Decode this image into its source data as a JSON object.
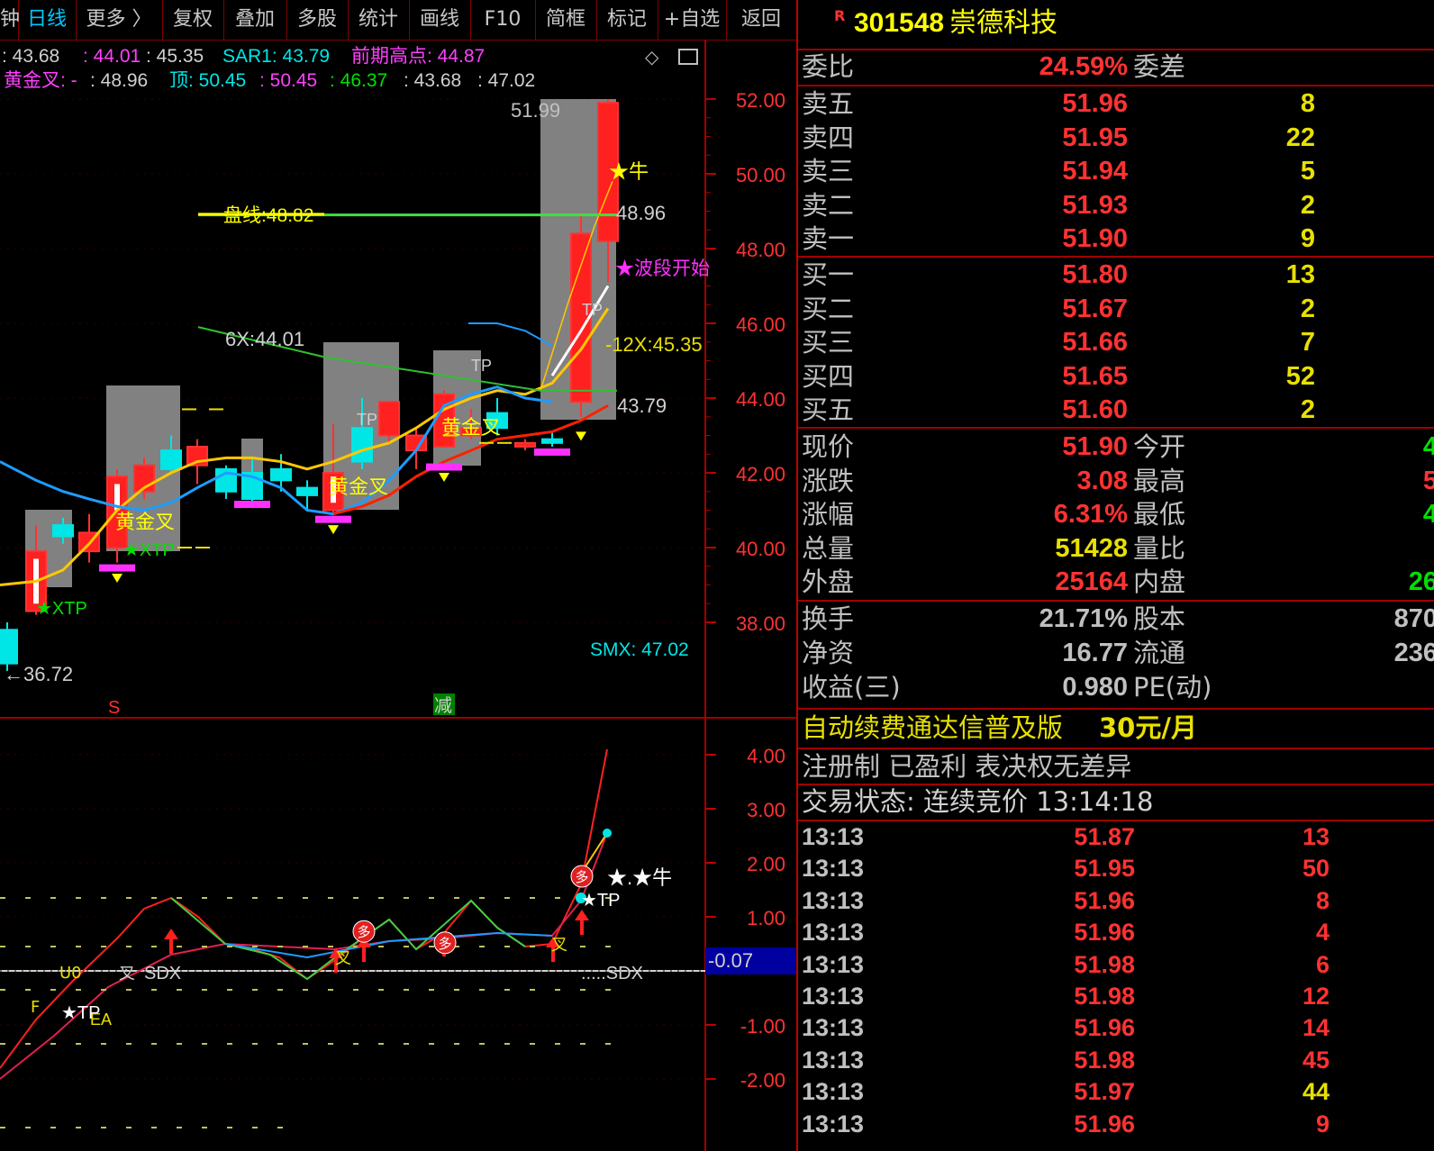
{
  "toolbar": {
    "items": [
      "钟",
      "日线",
      "更多 〉",
      "复权",
      "叠加",
      "多股",
      "统计",
      "画线",
      "F10",
      "简框",
      "标记",
      "+自选",
      "返回"
    ]
  },
  "indicator_line1": {
    "a": ": 43.68",
    "b": ": 44.01",
    "c": ": 45.35",
    "sar": "SAR1: 43.79",
    "prev_high": "前期高点: 44.87"
  },
  "indicator_line2": {
    "gold": "黄金叉: -",
    "v1": ": 48.96",
    "top": "顶: 50.45",
    "v2": ": 50.45",
    "v3": ": 46.37",
    "v4": ": 43.68",
    "v5": ": 47.02"
  },
  "price_axis": [
    "52.00",
    "50.00",
    "48.00",
    "46.00",
    "44.00",
    "42.00",
    "40.00",
    "38.00"
  ],
  "osc_axis": [
    "4.00",
    "3.00",
    "2.00",
    "1.00",
    "0.00",
    "-1.00",
    "-2.00"
  ],
  "osc_value": "-0.07",
  "chart_labels": {
    "high": "51.99",
    "low": "←36.72",
    "pan": "盘线:48.82",
    "line_4896": "48.96",
    "bull": "★牛",
    "wave": "★波段开始",
    "x6": "6X:44.01",
    "x12": "-12X:45.35",
    "sar": "43.79",
    "smx": "SMX: 47.02",
    "tp": "TP",
    "xtp": "XTP",
    "gold": "黄金叉",
    "s_marker": "S",
    "jian_marker": "减",
    "sdx": "SDX",
    "sdx2": ".....SDX",
    "tp_star": "★TP",
    "ea": "EA",
    "niu2": "★.★牛",
    "duo": "多",
    "cha": "叉"
  },
  "stock": {
    "flag": "R",
    "code": "301548",
    "name": "崇德科技"
  },
  "weibi": {
    "label": "委比",
    "value": "24.59%",
    "label2": "委差"
  },
  "sell": [
    {
      "label": "卖五",
      "price": "51.96",
      "vol": "8"
    },
    {
      "label": "卖四",
      "price": "51.95",
      "vol": "22"
    },
    {
      "label": "卖三",
      "price": "51.94",
      "vol": "5"
    },
    {
      "label": "卖二",
      "price": "51.93",
      "vol": "2"
    },
    {
      "label": "卖一",
      "price": "51.90",
      "vol": "9"
    }
  ],
  "buy": [
    {
      "label": "买一",
      "price": "51.80",
      "vol": "13"
    },
    {
      "label": "买二",
      "price": "51.67",
      "vol": "2"
    },
    {
      "label": "买三",
      "price": "51.66",
      "vol": "7"
    },
    {
      "label": "买四",
      "price": "51.65",
      "vol": "52"
    },
    {
      "label": "买五",
      "price": "51.60",
      "vol": "2"
    }
  ],
  "quote": [
    {
      "l": "现价",
      "v": "51.90",
      "l2": "今开",
      "v2": "4"
    },
    {
      "l": "涨跌",
      "v": "3.08",
      "l2": "最高",
      "v2": "5"
    },
    {
      "l": "涨幅",
      "v": "6.31%",
      "l2": "最低",
      "v2": "4"
    },
    {
      "l": "总量",
      "v": "51428",
      "l2": "量比",
      "v2": ""
    },
    {
      "l": "外盘",
      "v": "25164",
      "l2": "内盘",
      "v2": "26"
    }
  ],
  "fund": [
    {
      "l": "换手",
      "v": "21.71%",
      "l2": "股本",
      "v2": "870"
    },
    {
      "l": "净资",
      "v": "16.77",
      "l2": "流通",
      "v2": "236"
    },
    {
      "l": "收益(三)",
      "v": "0.980",
      "l2": "PE(动)",
      "v2": ""
    }
  ],
  "ad": {
    "text": "自动续费通达信普及版",
    "price": "30元/月"
  },
  "reg": "注册制 已盈利 表决权无差异",
  "status": "交易状态: 连续竞价 13:14:18",
  "ticks": [
    {
      "t": "13:13",
      "p": "51.87",
      "v": "13",
      "vc": "red"
    },
    {
      "t": "13:13",
      "p": "51.95",
      "v": "50",
      "vc": "red"
    },
    {
      "t": "13:13",
      "p": "51.96",
      "v": "8",
      "vc": "red"
    },
    {
      "t": "13:13",
      "p": "51.96",
      "v": "4",
      "vc": "red"
    },
    {
      "t": "13:13",
      "p": "51.98",
      "v": "6",
      "vc": "red"
    },
    {
      "t": "13:13",
      "p": "51.98",
      "v": "12",
      "vc": "red"
    },
    {
      "t": "13:13",
      "p": "51.96",
      "v": "14",
      "vc": "red"
    },
    {
      "t": "13:13",
      "p": "51.98",
      "v": "45",
      "vc": "red"
    },
    {
      "t": "13:13",
      "p": "51.97",
      "v": "44",
      "vc": "yel"
    },
    {
      "t": "13:13",
      "p": "51.96",
      "v": "9",
      "vc": "red"
    }
  ],
  "colors": {
    "up": "#ff3232",
    "down": "#00e6e6",
    "border": "#a00000",
    "ma_yellow": "#ffc800",
    "ma_blue": "#1e9cff",
    "ma_red": "#ff2000",
    "green_line": "#40e040"
  }
}
